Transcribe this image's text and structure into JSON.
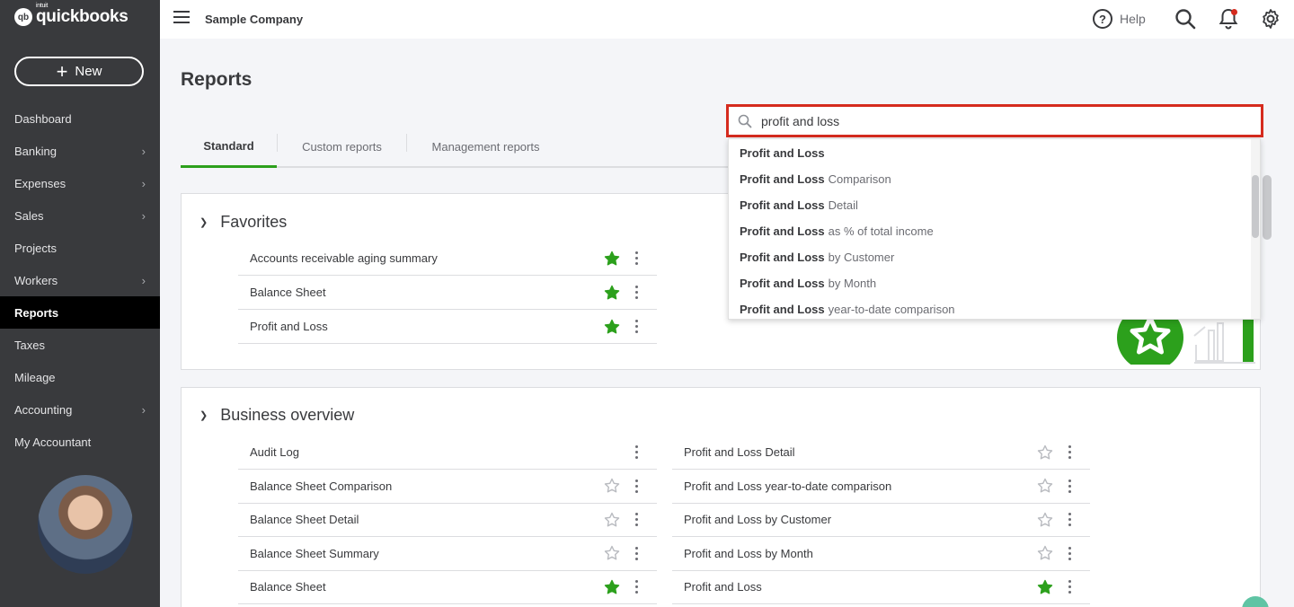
{
  "brand": {
    "prefix": "intuit",
    "name": "quickbooks",
    "mark": "qb"
  },
  "sidebar": {
    "new_label": "New",
    "items": [
      {
        "label": "Dashboard",
        "chevron": false,
        "active": false
      },
      {
        "label": "Banking",
        "chevron": true,
        "active": false
      },
      {
        "label": "Expenses",
        "chevron": true,
        "active": false
      },
      {
        "label": "Sales",
        "chevron": true,
        "active": false
      },
      {
        "label": "Projects",
        "chevron": false,
        "active": false
      },
      {
        "label": "Workers",
        "chevron": true,
        "active": false
      },
      {
        "label": "Reports",
        "chevron": false,
        "active": true
      },
      {
        "label": "Taxes",
        "chevron": false,
        "active": false
      },
      {
        "label": "Mileage",
        "chevron": false,
        "active": false
      },
      {
        "label": "Accounting",
        "chevron": true,
        "active": false
      },
      {
        "label": "My Accountant",
        "chevron": false,
        "active": false
      }
    ]
  },
  "topbar": {
    "company": "Sample Company",
    "help_label": "Help"
  },
  "page": {
    "title": "Reports"
  },
  "tabs": [
    {
      "label": "Standard",
      "active": true
    },
    {
      "label": "Custom reports",
      "active": false
    },
    {
      "label": "Management reports",
      "active": false
    }
  ],
  "search": {
    "value": "profit and loss",
    "results": [
      {
        "bold": "Profit and Loss",
        "rest": ""
      },
      {
        "bold": "Profit and Loss",
        "rest": "Comparison"
      },
      {
        "bold": "Profit and Loss",
        "rest": "Detail"
      },
      {
        "bold": "Profit and Loss",
        "rest": "as % of total income"
      },
      {
        "bold": "Profit and Loss",
        "rest": "by Customer"
      },
      {
        "bold": "Profit and Loss",
        "rest": "by Month"
      },
      {
        "bold": "Profit and Loss",
        "rest": "year-to-date comparison"
      }
    ]
  },
  "favorites": {
    "title": "Favorites",
    "rows": [
      {
        "label": "Accounts receivable aging summary",
        "favorite": true
      },
      {
        "label": "Balance Sheet",
        "favorite": true
      },
      {
        "label": "Profit and Loss",
        "favorite": true
      }
    ]
  },
  "business_overview": {
    "title": "Business overview",
    "left": [
      {
        "label": "Audit Log",
        "favorite": null
      },
      {
        "label": "Balance Sheet Comparison",
        "favorite": false
      },
      {
        "label": "Balance Sheet Detail",
        "favorite": false
      },
      {
        "label": "Balance Sheet Summary",
        "favorite": false
      },
      {
        "label": "Balance Sheet",
        "favorite": true
      }
    ],
    "right": [
      {
        "label": "Profit and Loss Detail",
        "favorite": false
      },
      {
        "label": "Profit and Loss year-to-date comparison",
        "favorite": false
      },
      {
        "label": "Profit and Loss by Customer",
        "favorite": false
      },
      {
        "label": "Profit and Loss by Month",
        "favorite": false
      },
      {
        "label": "Profit and Loss",
        "favorite": true
      }
    ]
  },
  "colors": {
    "accent": "#2ca01c",
    "sidebar": "#393a3d",
    "search_border": "#d52b1e"
  },
  "icons": [
    "menu-icon",
    "help-icon",
    "search-icon",
    "bell-icon",
    "gear-icon",
    "star-icon",
    "more-icon",
    "chevron-right-icon",
    "caret-down-icon"
  ]
}
